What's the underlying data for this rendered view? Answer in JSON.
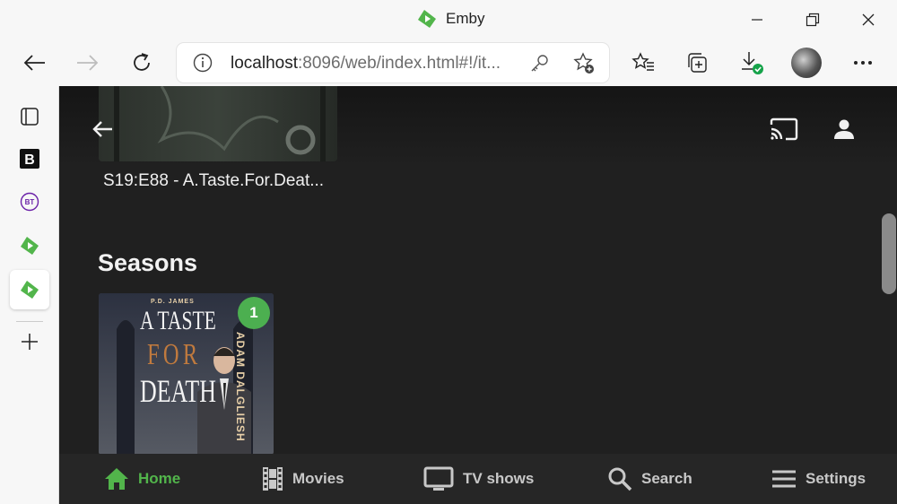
{
  "window": {
    "title": "Emby",
    "controls": [
      "minimize-icon",
      "restore-icon",
      "close-icon"
    ]
  },
  "browser": {
    "address": {
      "host": "localhost",
      "rest": ":8096/web/index.html#!/it..."
    }
  },
  "page": {
    "episode_title": "S19:E88 - A.Taste.For.Deat...",
    "section_heading": "Seasons",
    "season_badge": "1"
  },
  "poster": {
    "author": "P.D. JAMES",
    "title_line1": "A TASTE",
    "title_line2": "FOR",
    "title_line3": "DEATH",
    "side_text": "ADAM DALGLIESH"
  },
  "tabs": [
    {
      "label": "Home",
      "icon": "home-icon",
      "active": true
    },
    {
      "label": "Movies",
      "icon": "film-icon",
      "active": false
    },
    {
      "label": "TV shows",
      "icon": "tv-icon",
      "active": false
    },
    {
      "label": "Search",
      "icon": "search-icon",
      "active": false
    },
    {
      "label": "Settings",
      "icon": "menu-icon",
      "active": false
    }
  ],
  "colors": {
    "accent": "#52b54b",
    "badge": "#4caf50",
    "content_bg": "#202020",
    "tabbar_bg": "#262626"
  }
}
